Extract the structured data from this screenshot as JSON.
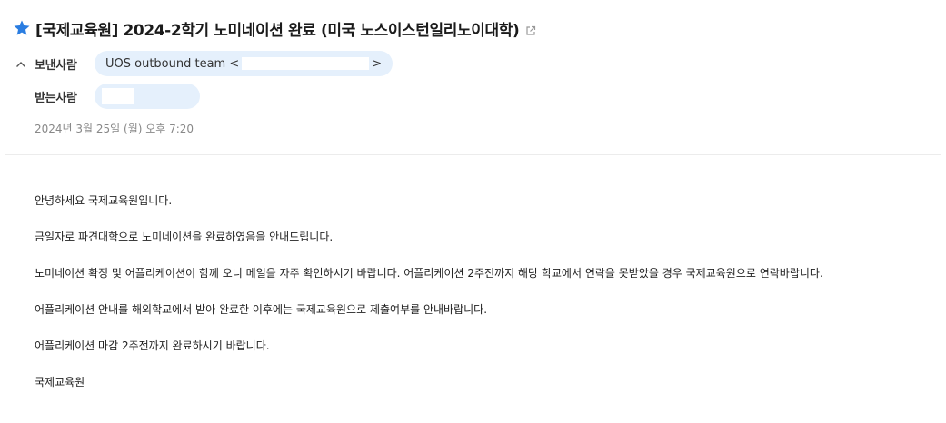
{
  "subject": "[국제교육원] 2024-2학기 노미네이션 완료 (미국 노스이스턴일리노이대학)",
  "icons": {
    "star": "star-icon",
    "popout": "external-link-icon",
    "toggle": "chevron-up-icon"
  },
  "colors": {
    "star": "#2a7de1",
    "chip_background": "#e5f0fc",
    "date_text": "#888888"
  },
  "from": {
    "label": "보낸사람",
    "sender_name": "UOS outbound team",
    "open_bracket": "<",
    "close_bracket": ">"
  },
  "to": {
    "label": "받는사람"
  },
  "date": "2024년 3월 25일 (월) 오후 7:20",
  "body": {
    "paragraphs": [
      "안녕하세요 국제교육원입니다.",
      "금일자로 파견대학으로 노미네이션을 완료하였음을 안내드립니다.",
      "노미네이션 확정 및 어플리케이션이 함께 오니 메일을 자주 확인하시기 바랍니다. 어플리케이션 2주전까지 해당 학교에서 연락을 못받았을 경우 국제교육원으로 연락바랍니다.",
      "어플리케이션 안내를 해외학교에서 받아 완료한 이후에는 국제교육원으로 제출여부를 안내바랍니다.",
      "어플리케이션 마감 2주전까지 완료하시기 바랍니다.",
      "국제교육원"
    ]
  }
}
